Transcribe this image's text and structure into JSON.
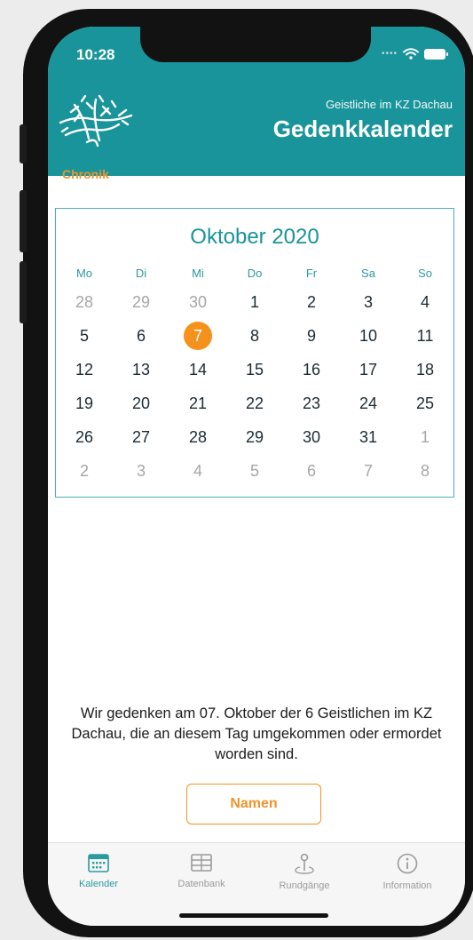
{
  "status": {
    "time": "10:28"
  },
  "header": {
    "subtitle": "Geistliche im KZ Dachau",
    "title": "Gedenkkalender"
  },
  "section": {
    "label": "Chronik"
  },
  "calendar": {
    "month_title": "Oktober 2020",
    "weekdays": [
      "Mo",
      "Di",
      "Mi",
      "Do",
      "Fr",
      "Sa",
      "So"
    ],
    "weeks": [
      [
        "28",
        "29",
        "30",
        "1",
        "2",
        "3",
        "4"
      ],
      [
        "5",
        "6",
        "7",
        "8",
        "9",
        "10",
        "11"
      ],
      [
        "12",
        "13",
        "14",
        "15",
        "16",
        "17",
        "18"
      ],
      [
        "19",
        "20",
        "21",
        "22",
        "23",
        "24",
        "25"
      ],
      [
        "26",
        "27",
        "28",
        "29",
        "30",
        "31",
        "1"
      ],
      [
        "2",
        "3",
        "4",
        "5",
        "6",
        "7",
        "8"
      ]
    ],
    "selected_day": "7",
    "accent_color": "#18949a",
    "selected_color": "#f5921e"
  },
  "memorial": {
    "text": "Wir gedenken am 07. Oktober der 6 Geistlichen im KZ Dachau, die an diesem Tag umgekommen oder ermordet worden sind."
  },
  "actions": {
    "names_button": "Namen"
  },
  "tabbar": {
    "items": [
      {
        "label": "Kalender",
        "icon": "calendar-icon",
        "active": true
      },
      {
        "label": "Datenbank",
        "icon": "table-icon",
        "active": false
      },
      {
        "label": "Rundgänge",
        "icon": "map-pin-icon",
        "active": false
      },
      {
        "label": "Information",
        "icon": "info-icon",
        "active": false
      }
    ]
  }
}
